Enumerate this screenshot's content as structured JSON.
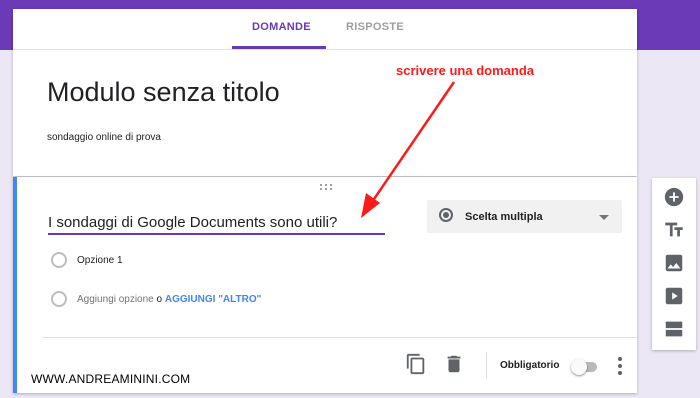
{
  "tabs": {
    "questions": "DOMANDE",
    "responses": "RISPOSTE"
  },
  "form": {
    "title": "Modulo senza titolo",
    "description": "sondaggio online di prova"
  },
  "question": {
    "text": "I sondaggi di Google Documents sono utili?",
    "type": "Scelta multipla",
    "options": [
      "Opzione 1"
    ],
    "add_option": "Aggiungi opzione",
    "or": "o",
    "add_other": "AGGIUNGI \"ALTRO\"",
    "required_label": "Obbligatorio",
    "required": false
  },
  "footer_icons": [
    "duplicate-icon",
    "trash-icon",
    "more-vert-icon"
  ],
  "side_toolbar": [
    "add-question-icon",
    "add-title-icon",
    "add-image-icon",
    "add-video-icon",
    "add-section-icon"
  ],
  "annotation": "scrivere una domanda",
  "watermark": "WWW.ANDREAMININI.COM",
  "colors": {
    "theme": "#673ab7",
    "band": "#6a3ab7",
    "background": "#ece7f5",
    "active_border": "#4285f4",
    "link": "#4285f4",
    "annotation": "#ff1a1a"
  }
}
